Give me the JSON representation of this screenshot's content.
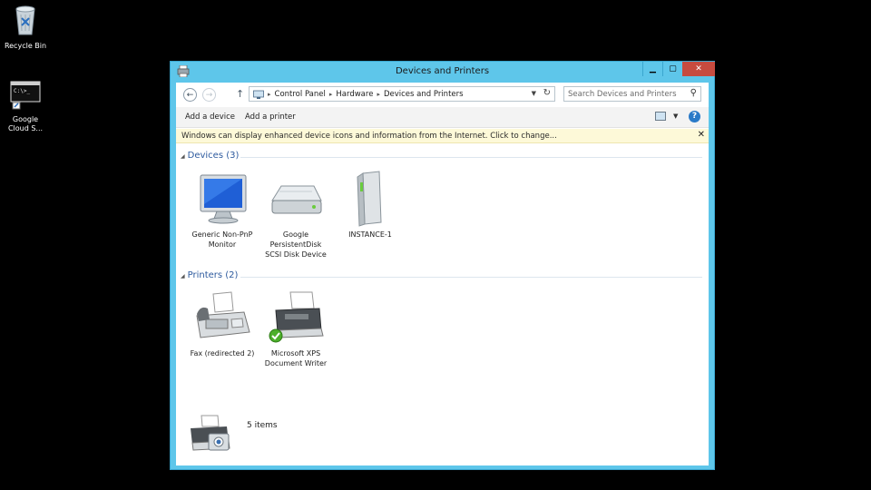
{
  "desktop": {
    "icons": [
      {
        "label": "Recycle Bin",
        "icon": "recycle-bin-icon"
      },
      {
        "label": "Google Cloud S...",
        "icon": "cloud-sdk-shell-icon"
      }
    ]
  },
  "window": {
    "title": "Devices and Printers",
    "controls": {
      "minimize": "▁",
      "maximize": "▢",
      "close": "✕"
    }
  },
  "address_bar": {
    "breadcrumbs": [
      "Control Panel",
      "Hardware",
      "Devices and Printers"
    ],
    "search_placeholder": "Search Devices and Printers"
  },
  "command_bar": {
    "add_device": "Add a device",
    "add_printer": "Add a printer"
  },
  "info_bar": {
    "message": "Windows can display enhanced device icons and information from the Internet. Click to change..."
  },
  "groups": {
    "devices": {
      "header": "Devices (3)",
      "items": [
        {
          "name_line1": "Generic Non-PnP",
          "name_line2": "Monitor",
          "name_line3": "",
          "icon": "monitor-icon"
        },
        {
          "name_line1": "Google",
          "name_line2": "PersistentDisk",
          "name_line3": "SCSI Disk Device",
          "icon": "disk-drive-icon"
        },
        {
          "name_line1": "INSTANCE-1",
          "name_line2": "",
          "name_line3": "",
          "icon": "computer-tower-icon"
        }
      ]
    },
    "printers": {
      "header": "Printers (2)",
      "items": [
        {
          "name_line1": "Fax (redirected 2)",
          "name_line2": "",
          "icon": "fax-icon"
        },
        {
          "name_line1": "Microsoft XPS",
          "name_line2": "Document Writer",
          "icon": "printer-icon",
          "default": true
        }
      ]
    }
  },
  "status": {
    "count": "5 items",
    "icon": "devices-printers-icon"
  }
}
